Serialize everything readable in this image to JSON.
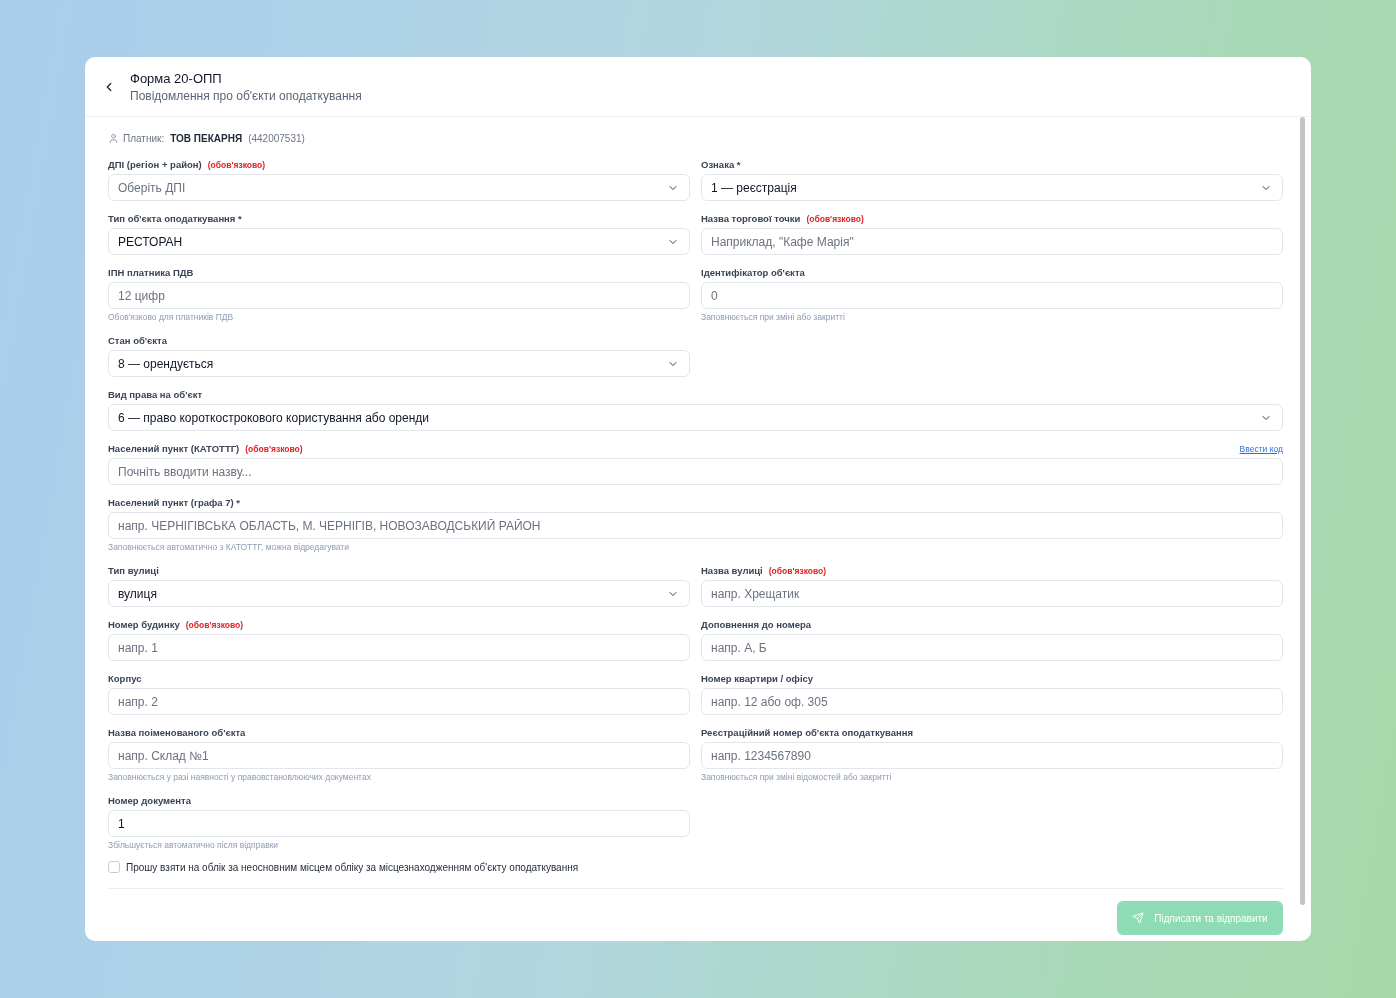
{
  "header": {
    "title": "Форма 20-ОПП",
    "subtitle": "Повідомлення про об'єкти оподаткування"
  },
  "payer": {
    "label": "Платник:",
    "name": "ТОВ ПЕКАРНЯ",
    "code": "(442007531)"
  },
  "rows": [
    {
      "fields": [
        {
          "kind": "select",
          "label": "ДПІ (регіон + район)",
          "required_note": "(обов'язково)",
          "placeholder": "Оберіть ДПІ"
        },
        {
          "kind": "select",
          "label": "Ознака *",
          "value": "1 — реєстрація"
        }
      ]
    },
    {
      "fields": [
        {
          "kind": "select",
          "label": "Тип об'єкта оподаткування *",
          "value": "РЕСТОРАН"
        },
        {
          "kind": "text",
          "label": "Назва торгової точки",
          "required_note": "(обов'язково)",
          "placeholder": "Наприклад, \"Кафе Марія\""
        }
      ]
    },
    {
      "fields": [
        {
          "kind": "text",
          "label": "ІПН платника ПДВ",
          "placeholder": "12 цифр",
          "hint": "Обов'язково для платників ПДВ"
        },
        {
          "kind": "text",
          "label": "Ідентифікатор об'єкта",
          "placeholder": "0",
          "hint": "Заповнюється при зміні або закритті"
        }
      ]
    },
    {
      "fields": [
        {
          "kind": "select",
          "label": "Стан об'єкта",
          "value": "8 — орендується"
        }
      ]
    },
    {
      "fields": [
        {
          "kind": "select",
          "label": "Вид права на об'єкт",
          "value": "6 — право короткострокового користування або оренди"
        }
      ]
    },
    {
      "fields": [
        {
          "kind": "text",
          "label": "Населений пункт (КАТОТТГ)",
          "required_note": "(обов'язково)",
          "link": "Ввести код",
          "placeholder": "Почніть вводити назву..."
        }
      ]
    },
    {
      "fields": [
        {
          "kind": "text",
          "label": "Населений пункт (графа 7) *",
          "placeholder": "напр. ЧЕРНІГІВСЬКА ОБЛАСТЬ, М. ЧЕРНІГІВ, НОВОЗАВОДСЬКИЙ РАЙОН",
          "hint": "Заповнюється автоматично з КАТОТТГ, можна відредагувати"
        }
      ]
    },
    {
      "fields": [
        {
          "kind": "select",
          "label": "Тип вулиці",
          "value": "вулиця"
        },
        {
          "kind": "text",
          "label": "Назва вулиці",
          "required_note": "(обов'язково)",
          "placeholder": "напр. Хрещатик"
        }
      ]
    },
    {
      "fields": [
        {
          "kind": "text",
          "label": "Номер будинку",
          "required_note": "(обов'язково)",
          "placeholder": "напр. 1"
        },
        {
          "kind": "text",
          "label": "Доповнення до номера",
          "placeholder": "напр. А, Б"
        }
      ]
    },
    {
      "fields": [
        {
          "kind": "text",
          "label": "Корпус",
          "placeholder": "напр. 2"
        },
        {
          "kind": "text",
          "label": "Номер квартири / офісу",
          "placeholder": "напр. 12 або оф. 305"
        }
      ]
    },
    {
      "fields": [
        {
          "kind": "text",
          "label": "Назва поіменованого об'єкта",
          "placeholder": "напр. Склад №1",
          "hint": "Заповнюється у разі наявності у правовстановлюючих документах"
        },
        {
          "kind": "text",
          "label": "Реєстраційний номер об'єкта оподаткування",
          "placeholder": "напр. 1234567890",
          "hint": "Заповнюється при зміні відомостей або закритті"
        }
      ]
    },
    {
      "fields": [
        {
          "kind": "text",
          "label": "Номер документа",
          "value": "1",
          "hint": "Збільшується автоматично після відправки"
        }
      ]
    }
  ],
  "checkbox": {
    "label": "Прошу взяти на облік за неосновним місцем обліку за місцезнаходженням об'єкту оподаткування",
    "checked": false
  },
  "submit": {
    "label": "Підписати та відправити",
    "disabled": true
  }
}
